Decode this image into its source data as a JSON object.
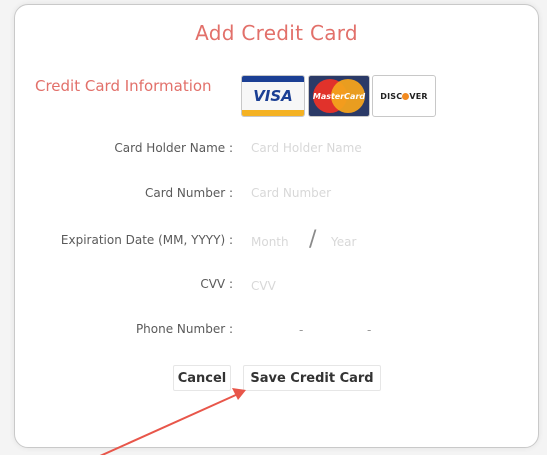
{
  "dialog": {
    "title": "Add Credit Card",
    "section_title": "Credit Card Information",
    "accent_color": "#e2706a"
  },
  "card_logos": [
    {
      "name": "visa",
      "label": "VISA"
    },
    {
      "name": "mastercard",
      "label": "MasterCard"
    },
    {
      "name": "discover",
      "label": "DISCOVER"
    }
  ],
  "form": {
    "card_holder_label": "Card Holder Name :",
    "card_holder_placeholder": "Card Holder Name",
    "card_number_label": "Card Number :",
    "card_number_placeholder": "Card Number",
    "expiration_label": "Expiration Date (MM, YYYY) :",
    "expiration_month_placeholder": "Month",
    "expiration_separator": "/",
    "expiration_year_placeholder": "Year",
    "cvv_label": "CVV :",
    "cvv_placeholder": "CVV",
    "phone_label": "Phone Number :",
    "phone_separator": "-"
  },
  "buttons": {
    "cancel": "Cancel",
    "save": "Save Credit Card"
  },
  "annotation": {
    "arrow_color": "#e8564a"
  }
}
